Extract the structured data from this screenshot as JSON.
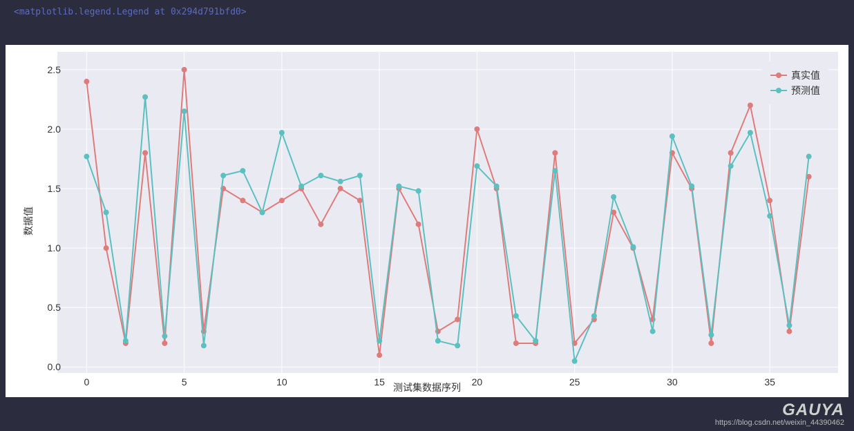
{
  "repl_output": "<matplotlib.legend.Legend at 0x294d791bfd0>",
  "chart_data": {
    "type": "line",
    "x": [
      0,
      1,
      2,
      3,
      4,
      5,
      6,
      7,
      8,
      9,
      10,
      11,
      12,
      13,
      14,
      15,
      16,
      17,
      18,
      19,
      20,
      21,
      22,
      23,
      24,
      25,
      26,
      27,
      28,
      29,
      30,
      31,
      32,
      33,
      34,
      35,
      36,
      37
    ],
    "series": [
      {
        "name": "真实值",
        "color": "#e07b7b",
        "values": [
          2.4,
          1.0,
          0.2,
          1.8,
          0.2,
          2.5,
          0.3,
          1.5,
          1.4,
          1.3,
          1.4,
          1.5,
          1.2,
          1.5,
          1.4,
          0.1,
          1.5,
          1.2,
          0.3,
          0.4,
          2.0,
          1.5,
          0.2,
          0.2,
          1.8,
          0.2,
          0.4,
          1.3,
          1.0,
          0.4,
          1.8,
          1.5,
          0.2,
          1.8,
          2.2,
          1.4,
          0.3,
          1.6
        ]
      },
      {
        "name": "预测值",
        "color": "#5bc0c0",
        "values": [
          1.77,
          1.3,
          0.22,
          2.27,
          0.26,
          2.15,
          0.18,
          1.61,
          1.65,
          1.3,
          1.97,
          1.52,
          1.61,
          1.56,
          1.61,
          0.22,
          1.52,
          1.48,
          0.22,
          0.18,
          1.69,
          1.52,
          0.43,
          0.22,
          1.65,
          0.05,
          0.43,
          1.43,
          1.01,
          0.3,
          1.94,
          1.52,
          0.27,
          1.69,
          1.97,
          1.27,
          0.35,
          1.77
        ]
      }
    ],
    "xlabel": "测试集数据序列",
    "ylabel": "数据值",
    "xlim": [
      -1.5,
      38.5
    ],
    "ylim": [
      -0.05,
      2.65
    ],
    "xticks": [
      0,
      5,
      10,
      15,
      20,
      25,
      30,
      35
    ],
    "yticks": [
      0.0,
      0.5,
      1.0,
      1.5,
      2.0,
      2.5
    ],
    "legend_position": "upper right"
  },
  "watermark": {
    "logo": "GAUYA",
    "url": "https://blog.csdn.net/weixin_44390462"
  }
}
